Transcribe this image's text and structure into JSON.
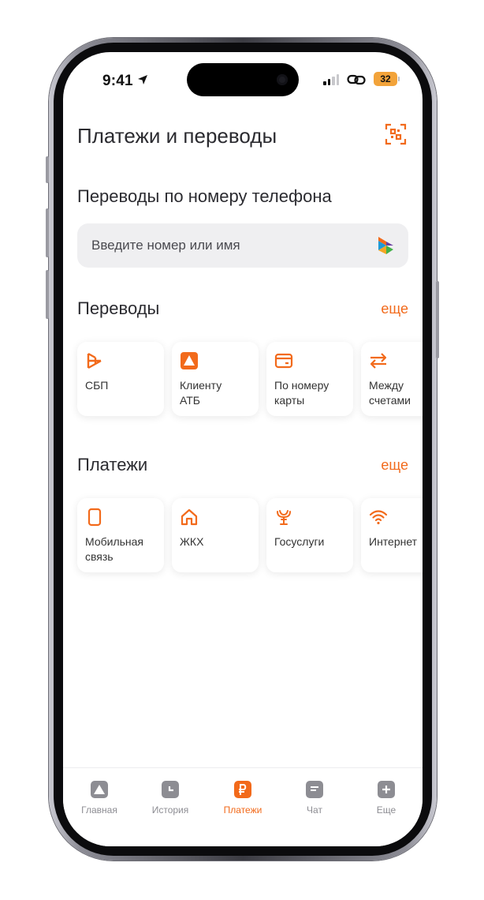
{
  "status_bar": {
    "time": "9:41",
    "battery": "32"
  },
  "header": {
    "title": "Платежи и переводы"
  },
  "phone_transfer": {
    "title": "Переводы по номеру телефона",
    "placeholder": "Введите номер или имя"
  },
  "transfers": {
    "title": "Переводы",
    "more": "еще",
    "items": [
      {
        "label": "СБП",
        "icon": "sbp-icon"
      },
      {
        "label": "Клиенту\nАТБ",
        "icon": "atb-logo-icon"
      },
      {
        "label": "По номеру\nкарты",
        "icon": "card-icon"
      },
      {
        "label": "Между\nсчетами",
        "icon": "swap-arrows-icon"
      }
    ]
  },
  "payments": {
    "title": "Платежи",
    "more": "еще",
    "items": [
      {
        "label": "Мобильная\nсвязь",
        "icon": "mobile-phone-icon"
      },
      {
        "label": "ЖКХ",
        "icon": "house-icon"
      },
      {
        "label": "Госуслуги",
        "icon": "emblem-icon"
      },
      {
        "label": "Интернет",
        "icon": "wifi-icon"
      }
    ]
  },
  "tabbar": {
    "items": [
      {
        "label": "Главная",
        "icon": "home-logo-icon",
        "active": false
      },
      {
        "label": "История",
        "icon": "clock-icon",
        "active": false
      },
      {
        "label": "Платежи",
        "icon": "ruble-icon",
        "active": true
      },
      {
        "label": "Чат",
        "icon": "chat-icon",
        "active": false
      },
      {
        "label": "Еще",
        "icon": "plus-icon",
        "active": false
      }
    ]
  },
  "colors": {
    "accent": "#f26a1b",
    "text": "#2b2b30",
    "muted": "#8d8d93",
    "field": "#efeff1"
  }
}
